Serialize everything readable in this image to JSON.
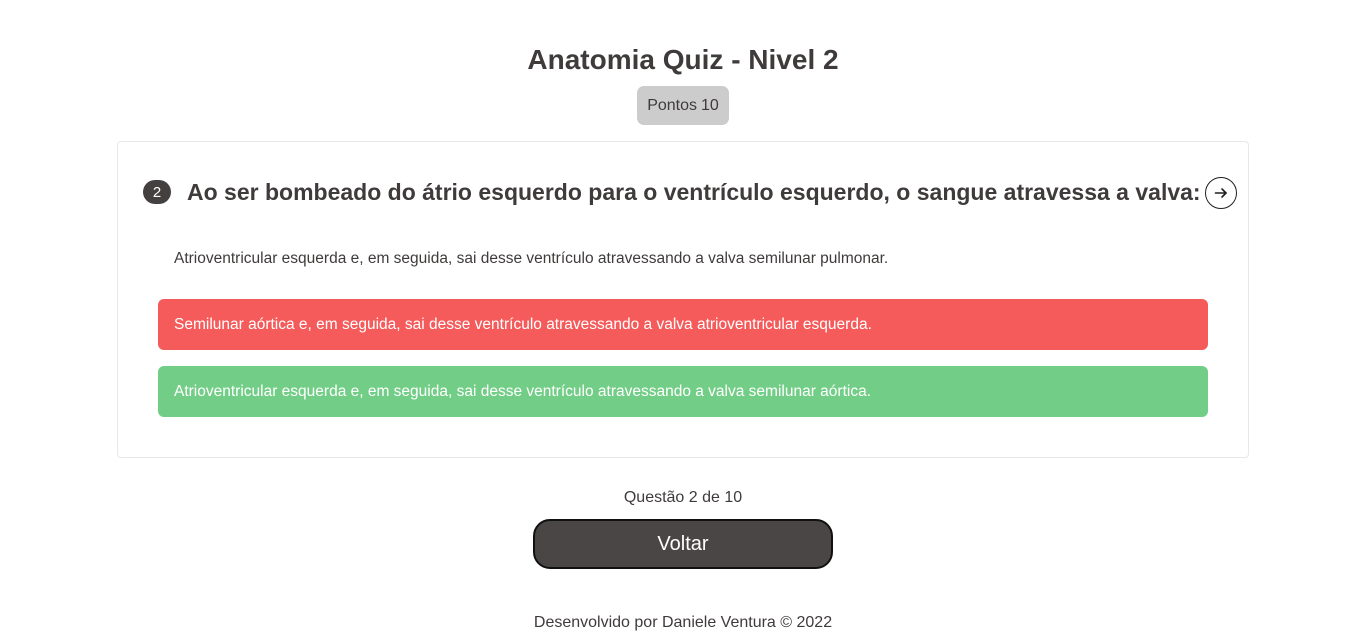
{
  "header": {
    "title": "Anatomia Quiz - Nivel 2",
    "score_label": "Pontos",
    "score_value": "10"
  },
  "question": {
    "number": "2",
    "text": "Ao ser bombeado do átrio esquerdo para o ventrículo esquerdo, o sangue atravessa a valva:",
    "next_icon": "arrow-right-circle-icon",
    "options": [
      {
        "text": "Atrioventricular esquerda e, em seguida, sai desse ventrículo atravessando a valva semilunar pulmonar.",
        "state": "neutral"
      },
      {
        "text": "Semilunar aórtica e, em seguida, sai desse ventrículo atravessando a valva atrioventricular esquerda.",
        "state": "wrong"
      },
      {
        "text": "Atrioventricular esquerda e, em seguida, sai desse ventrículo atravessando a valva semilunar aórtica.",
        "state": "correct"
      }
    ]
  },
  "progress": {
    "text": "Questão 2 de 10"
  },
  "actions": {
    "back_label": "Voltar"
  },
  "footer": {
    "text": "Desenvolvido por Daniele Ventura © 2022"
  },
  "colors": {
    "wrong": "#f55b5b",
    "correct": "#72ce86",
    "text": "#3f3b3b",
    "score_bg": "#cccccc",
    "button_bg": "#4a4646"
  }
}
